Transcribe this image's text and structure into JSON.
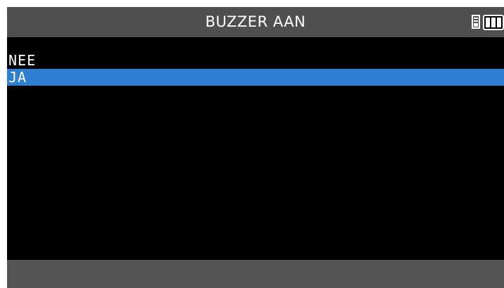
{
  "header": {
    "title": "BUZZER  AAN",
    "status_icons": [
      "sd-card-icon",
      "battery-icon"
    ],
    "battery_level": "3/3"
  },
  "menu": {
    "items": [
      {
        "label": "NEE",
        "selected": false
      },
      {
        "label": "JA",
        "selected": true
      }
    ]
  },
  "colors": {
    "screen_bg": "#000000",
    "header_bg": "#4f4f4f",
    "footer_bg": "#555555",
    "selection": "#2e7fd2",
    "text": "#ffffff"
  }
}
